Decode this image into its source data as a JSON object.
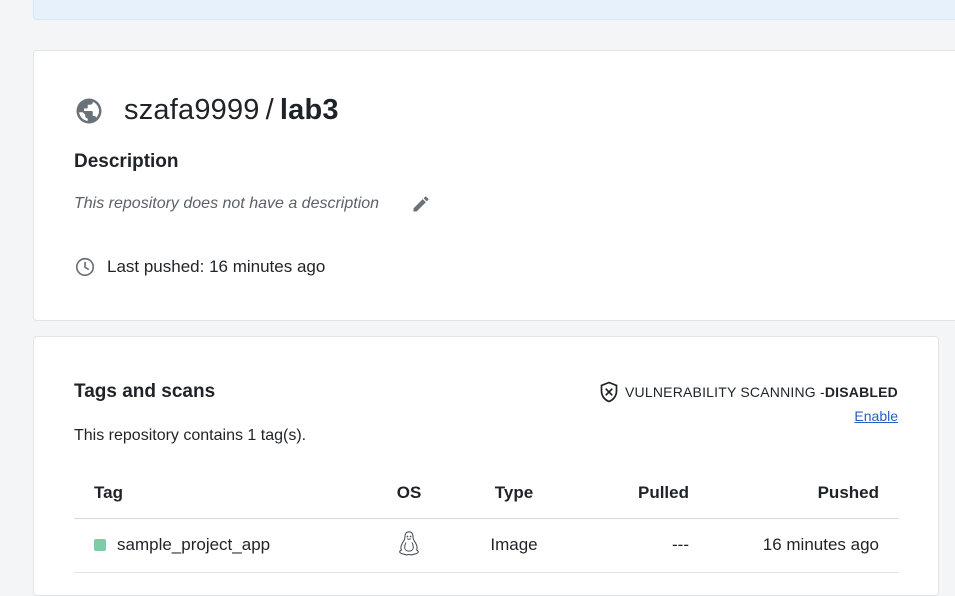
{
  "repo": {
    "namespace": "szafa9999",
    "separator": "/",
    "name": "lab3",
    "visibility_icon": "globe-icon",
    "description_heading": "Description",
    "description_text": "This repository does not have a description",
    "last_pushed": "Last pushed: 16 minutes ago"
  },
  "tags": {
    "heading": "Tags and scans",
    "count_text": "This repository contains 1 tag(s).",
    "scan_label": "VULNERABILITY SCANNING - ",
    "scan_status": "DISABLED",
    "enable_label": "Enable",
    "columns": {
      "tag": "Tag",
      "os": "OS",
      "type": "Type",
      "pulled": "Pulled",
      "pushed": "Pushed"
    },
    "rows": [
      {
        "tag": "sample_project_app",
        "os_icon": "linux-icon",
        "type": "Image",
        "pulled": "---",
        "pushed": "16 minutes ago"
      }
    ]
  },
  "colors": {
    "banner": "#e6f1fc",
    "link": "#2560c5",
    "tag_status": "#7dcca9"
  }
}
